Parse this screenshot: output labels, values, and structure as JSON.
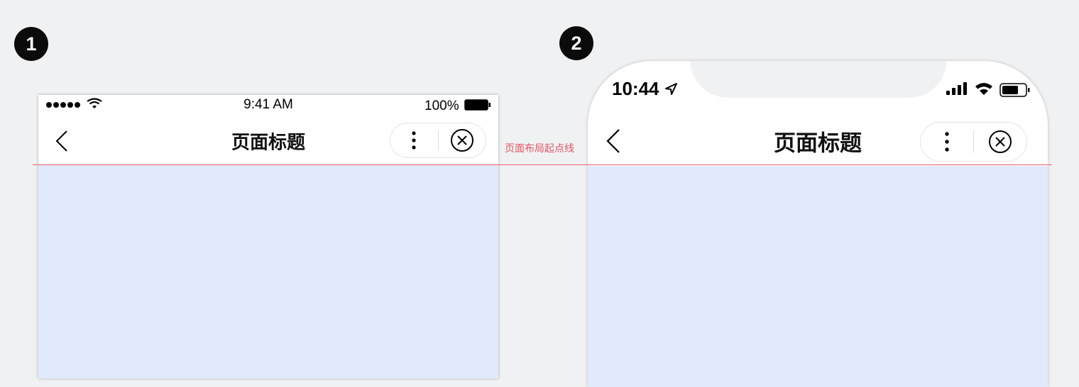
{
  "badges": {
    "first": "1",
    "second": "2"
  },
  "phone1": {
    "status_time": "9:41 AM",
    "battery_percent": "100%",
    "signal_dots": 5,
    "nav": {
      "title": "页面标题"
    }
  },
  "phone2": {
    "status_time": "10:44",
    "nav": {
      "title": "页面标题"
    }
  },
  "guide_label": "页面布局起点线",
  "colors": {
    "background": "#f0f1f3",
    "content_area": "#e1e9fc",
    "guide_line": "#e8616a",
    "badge": "#0b0b0b"
  },
  "icons": {
    "back": "chevron-left-icon",
    "menu": "more-vertical-icon",
    "close": "close-circle-icon",
    "wifi": "wifi-icon",
    "battery": "battery-icon",
    "signal": "signal-bars-icon",
    "location": "location-arrow-icon"
  }
}
